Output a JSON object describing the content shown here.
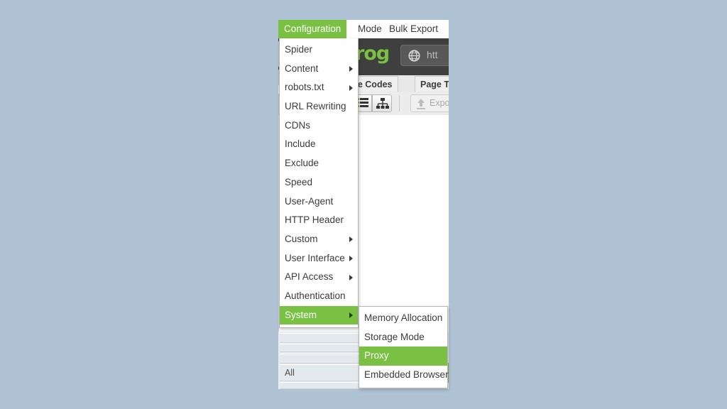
{
  "theme": {
    "desktop_background": "#afc2d4",
    "accent_green": "#7ac143",
    "menu_text": "#3b3b3b",
    "header_dark": "#3f3f3f"
  },
  "menubar": {
    "items": [
      {
        "label": "Configuration",
        "active": true
      },
      {
        "label": "Mode",
        "active": false
      },
      {
        "label": "Bulk Export",
        "active": false
      }
    ]
  },
  "app_header": {
    "logo_text": "rog",
    "url_value": "htt",
    "globe_icon": "globe-icon"
  },
  "tabs": [
    {
      "label": "ponse Codes"
    },
    {
      "label": "Page T"
    }
  ],
  "toolbar": {
    "view_list_icon": "list-view-icon",
    "view_tree_icon": "tree-view-icon",
    "export_label": "Expo",
    "export_icon": "upload-icon"
  },
  "bottom_panel": {
    "all_label": "All"
  },
  "configuration_menu": {
    "items": [
      {
        "label": "Spider",
        "has_submenu": false,
        "selected": false
      },
      {
        "label": "Content",
        "has_submenu": true,
        "selected": false
      },
      {
        "label": "robots.txt",
        "has_submenu": true,
        "selected": false
      },
      {
        "label": "URL Rewriting",
        "has_submenu": false,
        "selected": false
      },
      {
        "label": "CDNs",
        "has_submenu": false,
        "selected": false
      },
      {
        "label": "Include",
        "has_submenu": false,
        "selected": false
      },
      {
        "label": "Exclude",
        "has_submenu": false,
        "selected": false
      },
      {
        "label": "Speed",
        "has_submenu": false,
        "selected": false
      },
      {
        "label": "User-Agent",
        "has_submenu": false,
        "selected": false
      },
      {
        "label": "HTTP Header",
        "has_submenu": false,
        "selected": false
      },
      {
        "label": "Custom",
        "has_submenu": true,
        "selected": false
      },
      {
        "label": "User Interface",
        "has_submenu": true,
        "selected": false
      },
      {
        "label": "API Access",
        "has_submenu": true,
        "selected": false
      },
      {
        "label": "Authentication",
        "has_submenu": false,
        "selected": false
      },
      {
        "label": "System",
        "has_submenu": true,
        "selected": true
      }
    ]
  },
  "system_submenu": {
    "items": [
      {
        "label": "Memory Allocation",
        "selected": false
      },
      {
        "label": "Storage Mode",
        "selected": false
      },
      {
        "label": "Proxy",
        "selected": true
      },
      {
        "label": "Embedded Browser",
        "selected": false
      }
    ]
  }
}
